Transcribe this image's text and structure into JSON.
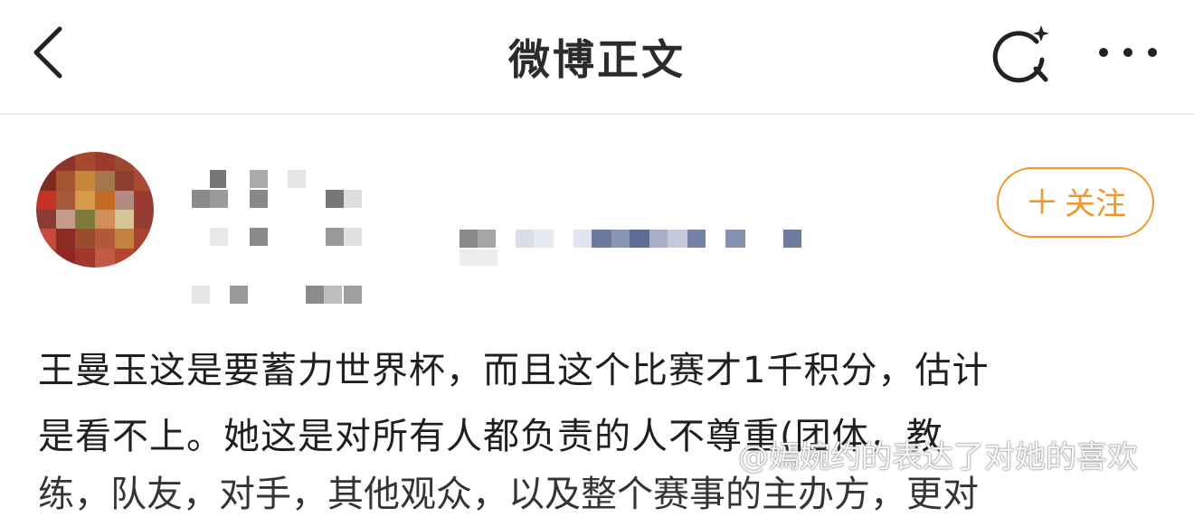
{
  "header": {
    "title": "微博正文",
    "back_icon": "chevron-left-icon",
    "search_icon": "search-sparkle-icon",
    "more_icon": "more-dots-icon"
  },
  "author": {
    "avatar": "avatar-icon",
    "follow_plus": "＋",
    "follow_label": "关注"
  },
  "post": {
    "line1": "王曼玉这是要蓄力世界杯，而且这个比赛才1千积分，估计",
    "line2": "是看不上。她这是对所有人都负责的人不尊重(团体，教",
    "line3": "练，队友，对手，其他观众，以及整个赛事的主办方，更对"
  },
  "watermark": "@嫣婉约的表达了对她的喜欢",
  "colors": {
    "accent": "#f0962a",
    "divider": "#ececec",
    "text": "#1f1f1f"
  }
}
